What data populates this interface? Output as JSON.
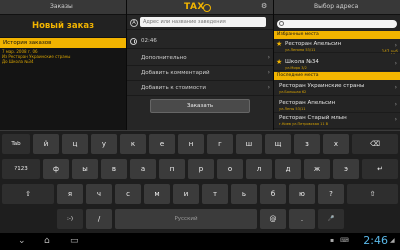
{
  "left": {
    "bar_title": "Заказы",
    "new_order": "Новый заказ",
    "history_header": "История заказов",
    "history_item_date": "7 мар. 2008 г. 06",
    "history_item_from": "Из Ресторан Украинские страны",
    "history_item_to": "До Школа №34",
    "history_item_time": "147 руб"
  },
  "middle": {
    "logo": "TAX",
    "address_placeholder": "Адрес или название заведения",
    "badge_a": "A",
    "time": "02:46",
    "additional": "Дополнительно",
    "add_comment": "Добавить комментарий",
    "add_to_cost": "Добавить к стоимости",
    "order_button": "Заказать"
  },
  "right": {
    "bar_title": "Выбор адреса",
    "favorites_header": "Избранные места",
    "recent_header": "Последние места",
    "favorites": [
      {
        "name": "Ресторан Апельсин",
        "sub": "ул.Ленина 53/11"
      },
      {
        "name": "Школа №34",
        "sub": "ул.Мира 3/2"
      }
    ],
    "recent": [
      {
        "name": "Ресторан Украинские страны",
        "sub": "ул.Большая 62"
      },
      {
        "name": "Ресторан Апельсин",
        "sub": "ул.Лены 53/11"
      },
      {
        "name": "Ресторан Старый млын",
        "sub": "г.Киев ул.Петровская 11 В"
      }
    ]
  },
  "keyboard": {
    "row1": [
      "Tab",
      "й",
      "ц",
      "у",
      "к",
      "е",
      "н",
      "г",
      "ш",
      "щ",
      "з",
      "х",
      "⌫"
    ],
    "row2": [
      "?123",
      "ф",
      "ы",
      "в",
      "а",
      "п",
      "р",
      "о",
      "л",
      "д",
      "ж",
      "э",
      "↵"
    ],
    "row3": [
      "⇧",
      "я",
      "ч",
      "с",
      "м",
      "и",
      "т",
      "ь",
      "б",
      "ю",
      "?",
      "⇧"
    ],
    "row4_left": ":-)",
    "row4_slash": "/",
    "row4_space": "Русский",
    "row4_at": "@",
    "row4_dot": ".",
    "row4_voice": "🎤"
  },
  "system": {
    "clock": "2:46"
  },
  "colors": {
    "accent": "#f2b400",
    "clock": "#5ab8e8"
  }
}
